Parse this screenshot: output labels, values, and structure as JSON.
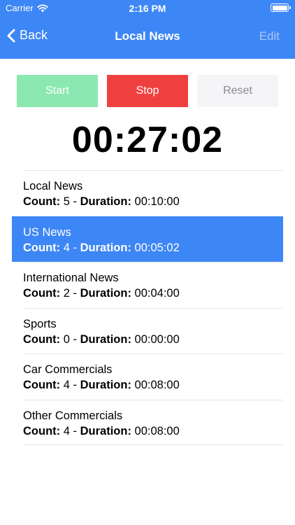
{
  "status": {
    "carrier": "Carrier",
    "time": "2:16 PM"
  },
  "nav": {
    "back_label": "Back",
    "title": "Local News",
    "edit_label": "Edit"
  },
  "controls": {
    "start_label": "Start",
    "stop_label": "Stop",
    "reset_label": "Reset"
  },
  "timer": "00:27:02",
  "labels": {
    "count": "Count:",
    "dash": "-",
    "duration": "Duration:"
  },
  "items": [
    {
      "title": "Local News",
      "count": "5",
      "duration": "00:10:00"
    },
    {
      "title": "US News",
      "count": "4",
      "duration": "00:05:02"
    },
    {
      "title": "International News",
      "count": "2",
      "duration": "00:04:00"
    },
    {
      "title": "Sports",
      "count": "0",
      "duration": "00:00:00"
    },
    {
      "title": "Car Commercials",
      "count": "4",
      "duration": "00:08:00"
    },
    {
      "title": "Other Commercials",
      "count": "4",
      "duration": "00:08:00"
    }
  ],
  "selected_index": 1,
  "colors": {
    "accent": "#3d86f5",
    "start": "#8be8b0",
    "stop": "#ef4040",
    "reset_bg": "#f5f5f7"
  },
  "icons": {
    "signal": "wifi-icon",
    "battery": "battery-icon",
    "back": "chevron-left-icon"
  }
}
